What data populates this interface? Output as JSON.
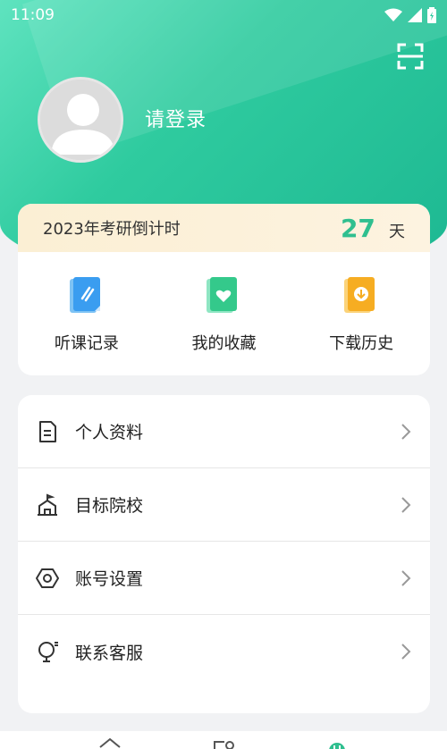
{
  "status_bar": {
    "time": "11:09"
  },
  "header": {
    "login_prompt": "请登录"
  },
  "countdown": {
    "label": "2023年考研倒计时",
    "days": "27",
    "unit": "天"
  },
  "quick_actions": [
    {
      "label": "听课记录",
      "icon": "lecture-record-icon"
    },
    {
      "label": "我的收藏",
      "icon": "favorites-icon"
    },
    {
      "label": "下载历史",
      "icon": "download-history-icon"
    }
  ],
  "menu": [
    {
      "label": "个人资料",
      "icon": "profile-document-icon"
    },
    {
      "label": "目标院校",
      "icon": "school-icon"
    },
    {
      "label": "账号设置",
      "icon": "settings-hexagon-icon"
    },
    {
      "label": "联系客服",
      "icon": "customer-service-icon"
    }
  ],
  "colors": {
    "accent": "#2fbf8f",
    "hero_start": "#5fe3bf",
    "hero_end": "#1db892"
  }
}
